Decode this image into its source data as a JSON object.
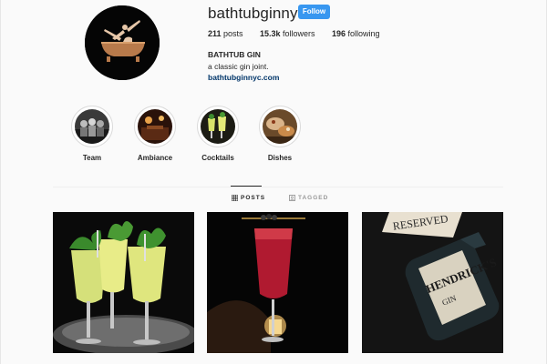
{
  "profile": {
    "username": "bathtubginnyc",
    "follow_label": "Follow",
    "avatar_icon": "bathtub-logo-icon",
    "stats": {
      "posts_count": "211",
      "posts_label": "posts",
      "followers_count": "15.3k",
      "followers_label": "followers",
      "following_count": "196",
      "following_label": "following"
    },
    "bio": {
      "name": "BATHTUB GIN",
      "description": "a classic gin joint.",
      "link": "bathtubginnyc.com"
    }
  },
  "highlights": [
    {
      "label": "Team"
    },
    {
      "label": "Ambiance"
    },
    {
      "label": "Cocktails"
    },
    {
      "label": "Dishes"
    }
  ],
  "tabs": {
    "posts_label": "POSTS",
    "tagged_label": "TAGGED",
    "posts_icon": "grid-icon",
    "tagged_icon": "tag-icon",
    "active": "POSTS"
  },
  "posts": [
    {
      "subject": "green-cocktails"
    },
    {
      "subject": "red-cocktail"
    },
    {
      "subject": "hendricks-gin-bottle"
    }
  ],
  "colors": {
    "follow_button": "#3897f0",
    "link": "#003569",
    "background": "#fafafa"
  }
}
